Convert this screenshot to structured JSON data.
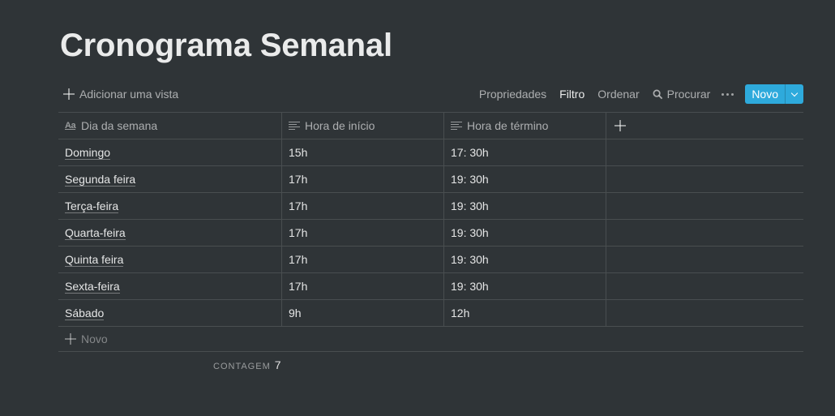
{
  "page": {
    "title": "Cronograma Semanal"
  },
  "toolbar": {
    "add_view": "Adicionar uma vista",
    "properties": "Propriedades",
    "filter": "Filtro",
    "sort": "Ordenar",
    "search": "Procurar",
    "new": "Novo"
  },
  "colors": {
    "accent": "#2eaadc",
    "background": "#2f3437"
  },
  "table": {
    "headers": [
      "Dia da semana",
      "Hora de início",
      "Hora de término"
    ],
    "header_icons": [
      "title-aa-icon",
      "text-lines-icon",
      "text-lines-icon"
    ],
    "rows": [
      [
        "Domingo",
        "15h",
        "17: 30h"
      ],
      [
        "Segunda feira",
        "17h",
        "19: 30h"
      ],
      [
        "Terça-feira",
        "17h",
        "19: 30h"
      ],
      [
        "Quarta-feira",
        "17h",
        "19: 30h"
      ],
      [
        "Quinta feira",
        "17h",
        "19: 30h"
      ],
      [
        "Sexta-feira",
        "17h",
        "19: 30h"
      ],
      [
        "Sábado",
        "9h",
        "12h"
      ]
    ],
    "new_row": "Novo"
  },
  "footer": {
    "count_label": "CONTAGEM",
    "count_value": "7"
  }
}
